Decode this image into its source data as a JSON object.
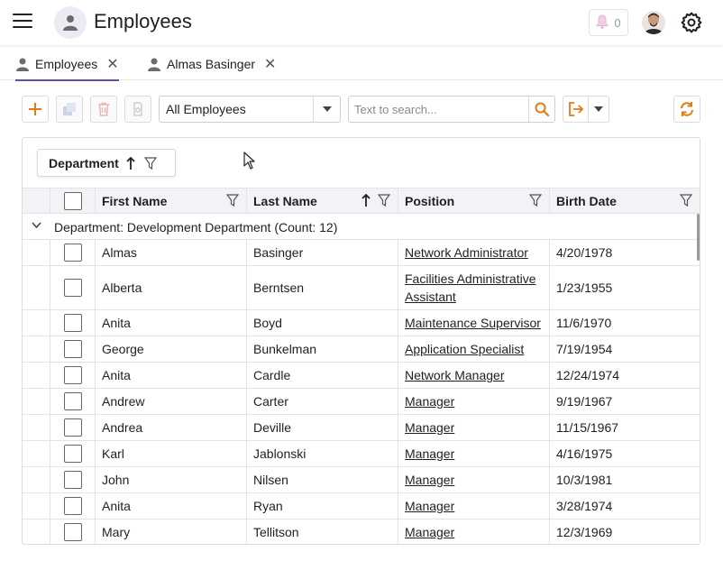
{
  "header": {
    "title": "Employees",
    "notification_count": "0"
  },
  "tabs": [
    {
      "label": "Employees",
      "active": true
    },
    {
      "label": "Almas Basinger",
      "active": false
    }
  ],
  "toolbar": {
    "filter_select_value": "All Employees",
    "search_placeholder": "Text to search..."
  },
  "grid": {
    "group_panel_chip": "Department",
    "columns": [
      "First Name",
      "Last Name",
      "Position",
      "Birth Date"
    ],
    "group_header": "Department: Development Department (Count: 12)",
    "rows": [
      {
        "first": "Almas",
        "last": "Basinger",
        "position": [
          "Network Administrator"
        ],
        "birth": "4/20/1978"
      },
      {
        "first": "Alberta",
        "last": "Berntsen",
        "position": [
          "Facilities Administrative",
          "Assistant"
        ],
        "birth": "1/23/1955"
      },
      {
        "first": "Anita",
        "last": "Boyd",
        "position": [
          "Maintenance Supervisor"
        ],
        "birth": "11/6/1970"
      },
      {
        "first": "George",
        "last": "Bunkelman",
        "position": [
          "Application Specialist"
        ],
        "birth": "7/19/1954"
      },
      {
        "first": "Anita",
        "last": "Cardle",
        "position": [
          "Network Manager"
        ],
        "birth": "12/24/1974"
      },
      {
        "first": "Andrew",
        "last": "Carter",
        "position": [
          "Manager"
        ],
        "birth": "9/19/1967"
      },
      {
        "first": "Andrea",
        "last": "Deville",
        "position": [
          "Manager"
        ],
        "birth": "11/15/1967"
      },
      {
        "first": "Karl",
        "last": "Jablonski",
        "position": [
          "Manager"
        ],
        "birth": "4/16/1975"
      },
      {
        "first": "John",
        "last": "Nilsen",
        "position": [
          "Manager"
        ],
        "birth": "10/3/1981"
      },
      {
        "first": "Anita",
        "last": "Ryan",
        "position": [
          "Manager"
        ],
        "birth": "3/28/1974"
      },
      {
        "first": "Mary",
        "last": "Tellitson",
        "position": [
          "Manager"
        ],
        "birth": "12/3/1969"
      }
    ]
  },
  "colors": {
    "accent": "#6c4c9c",
    "action_orange": "#e07b16",
    "header_bg": "#f5f2f7",
    "border": "#e3e3e3"
  },
  "icons": {
    "menu": "hamburger-icon",
    "app": "user-icon",
    "notifications": "bell-icon",
    "settings": "gear-icon",
    "add": "plus-icon",
    "copy": "copy-icon",
    "delete": "trash-icon",
    "print": "printer-icon",
    "search": "magnifier-icon",
    "export": "export-icon",
    "refresh": "refresh-icon"
  }
}
